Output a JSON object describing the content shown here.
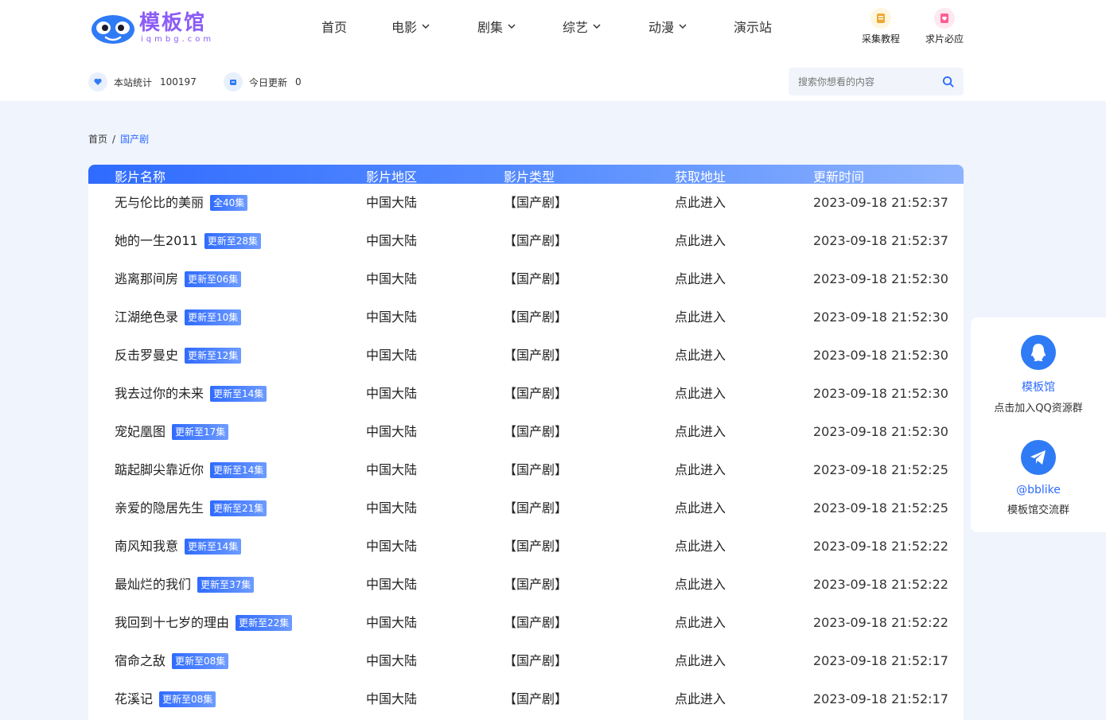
{
  "brand": {
    "logo_text": "模板馆",
    "logo_domain": "iqmbg.com",
    "accent": "#2f6bff",
    "logo_color": "#8b5cf6"
  },
  "nav": {
    "items": [
      {
        "label": "首页",
        "has_dropdown": false
      },
      {
        "label": "电影",
        "has_dropdown": true
      },
      {
        "label": "剧集",
        "has_dropdown": true
      },
      {
        "label": "综艺",
        "has_dropdown": true
      },
      {
        "label": "动漫",
        "has_dropdown": true
      },
      {
        "label": "演示站",
        "has_dropdown": false
      }
    ],
    "tools": [
      {
        "label": "采集教程",
        "icon": "notebook-icon"
      },
      {
        "label": "求片必应",
        "icon": "heart-book-icon"
      }
    ]
  },
  "stats": {
    "total_label": "本站统计",
    "total_value": "100197",
    "today_label": "今日更新",
    "today_value": "0"
  },
  "search": {
    "placeholder": "搜索你想看的内容"
  },
  "breadcrumb": {
    "home": "首页",
    "separator": "/",
    "current": "国产剧"
  },
  "table": {
    "headers": [
      "影片名称",
      "影片地区",
      "影片类型",
      "获取地址",
      "更新时间"
    ],
    "rows": [
      {
        "name": "无与伦比的美丽",
        "badge": "全40集",
        "region": "中国大陆",
        "type": "【国产剧】",
        "link": "点此进入",
        "time": "2023-09-18 21:52:37"
      },
      {
        "name": "她的一生2011",
        "badge": "更新至28集",
        "region": "中国大陆",
        "type": "【国产剧】",
        "link": "点此进入",
        "time": "2023-09-18 21:52:37"
      },
      {
        "name": "逃离那间房",
        "badge": "更新至06集",
        "region": "中国大陆",
        "type": "【国产剧】",
        "link": "点此进入",
        "time": "2023-09-18 21:52:30"
      },
      {
        "name": "江湖绝色录",
        "badge": "更新至10集",
        "region": "中国大陆",
        "type": "【国产剧】",
        "link": "点此进入",
        "time": "2023-09-18 21:52:30"
      },
      {
        "name": "反击罗曼史",
        "badge": "更新至12集",
        "region": "中国大陆",
        "type": "【国产剧】",
        "link": "点此进入",
        "time": "2023-09-18 21:52:30"
      },
      {
        "name": "我去过你的未来",
        "badge": "更新至14集",
        "region": "中国大陆",
        "type": "【国产剧】",
        "link": "点此进入",
        "time": "2023-09-18 21:52:30"
      },
      {
        "name": "宠妃凰图",
        "badge": "更新至17集",
        "region": "中国大陆",
        "type": "【国产剧】",
        "link": "点此进入",
        "time": "2023-09-18 21:52:30"
      },
      {
        "name": "踮起脚尖靠近你",
        "badge": "更新至14集",
        "region": "中国大陆",
        "type": "【国产剧】",
        "link": "点此进入",
        "time": "2023-09-18 21:52:25"
      },
      {
        "name": "亲爱的隐居先生",
        "badge": "更新至21集",
        "region": "中国大陆",
        "type": "【国产剧】",
        "link": "点此进入",
        "time": "2023-09-18 21:52:25"
      },
      {
        "name": "南风知我意",
        "badge": "更新至14集",
        "region": "中国大陆",
        "type": "【国产剧】",
        "link": "点此进入",
        "time": "2023-09-18 21:52:22"
      },
      {
        "name": "最灿烂的我们",
        "badge": "更新至37集",
        "region": "中国大陆",
        "type": "【国产剧】",
        "link": "点此进入",
        "time": "2023-09-18 21:52:22"
      },
      {
        "name": "我回到十七岁的理由",
        "badge": "更新至22集",
        "region": "中国大陆",
        "type": "【国产剧】",
        "link": "点此进入",
        "time": "2023-09-18 21:52:22"
      },
      {
        "name": "宿命之敌",
        "badge": "更新至08集",
        "region": "中国大陆",
        "type": "【国产剧】",
        "link": "点此进入",
        "time": "2023-09-18 21:52:17"
      },
      {
        "name": "花溪记",
        "badge": "更新至08集",
        "region": "中国大陆",
        "type": "【国产剧】",
        "link": "点此进入",
        "time": "2023-09-18 21:52:17"
      }
    ]
  },
  "side_panel": {
    "items": [
      {
        "icon": "qq-icon",
        "title": "模板馆",
        "subtitle": "点击加入QQ资源群"
      },
      {
        "icon": "telegram-icon",
        "title": "@bblike",
        "subtitle": "模板馆交流群"
      }
    ]
  }
}
